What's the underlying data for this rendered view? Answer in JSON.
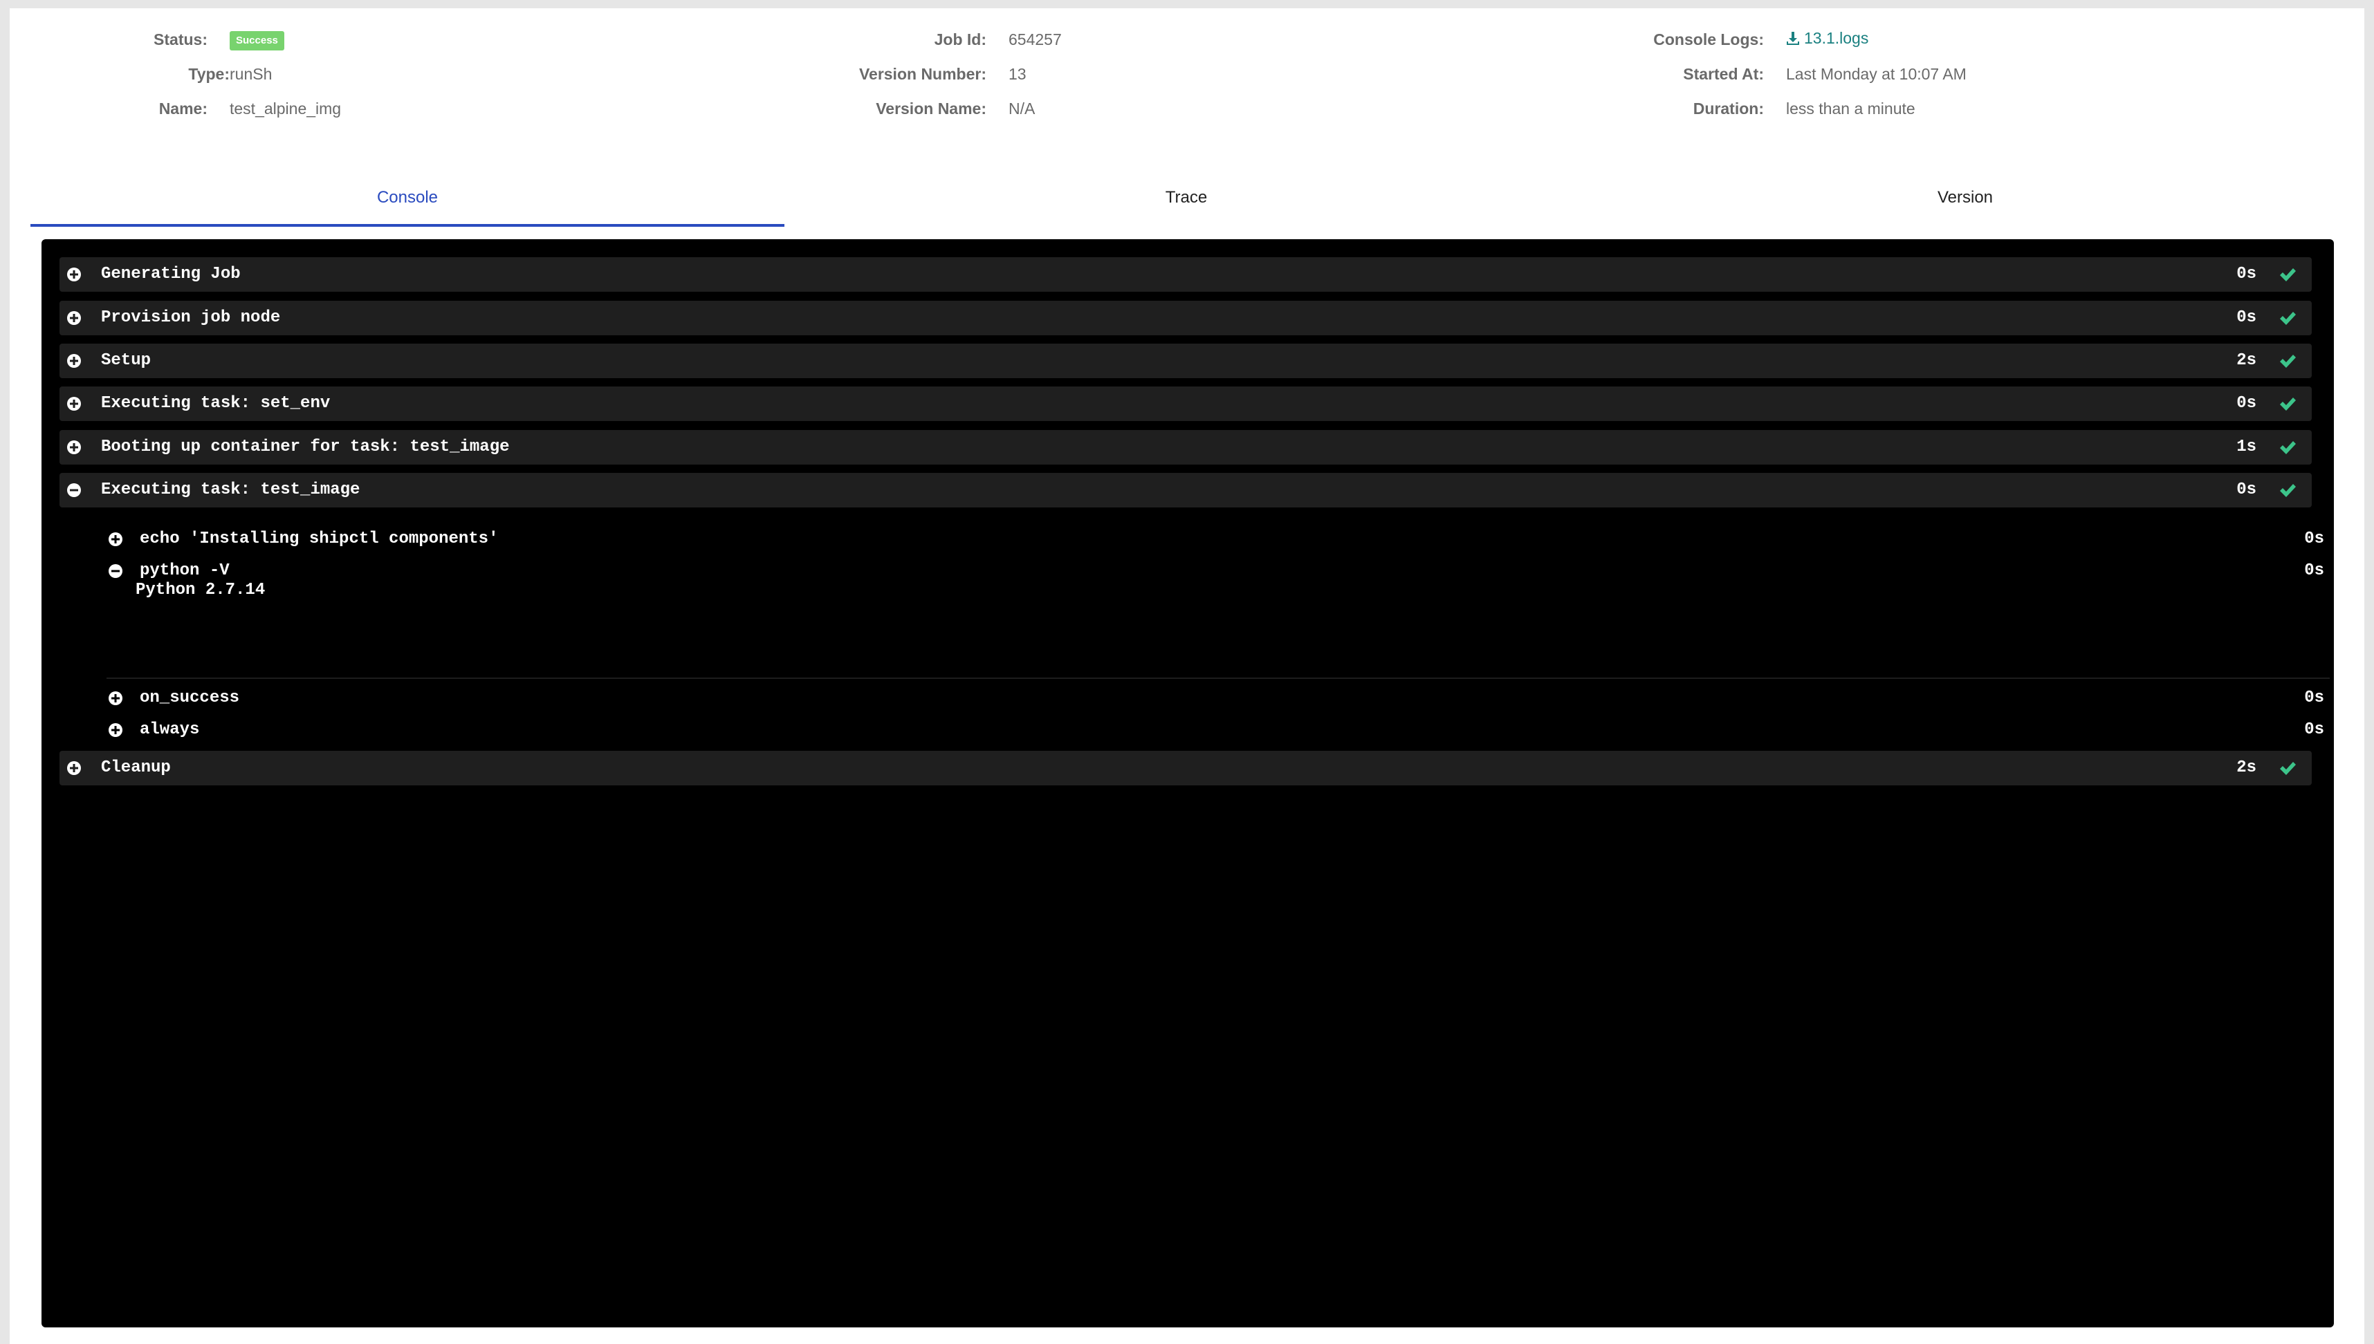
{
  "info": {
    "status_label": "Status:",
    "status_value": "Success",
    "type_label": "Type:",
    "type_value": "runSh",
    "name_label": "Name:",
    "name_value": "test_alpine_img",
    "job_id_label": "Job Id:",
    "job_id_value": "654257",
    "version_number_label": "Version Number:",
    "version_number_value": "13",
    "version_name_label": "Version Name:",
    "version_name_value": "N/A",
    "console_logs_label": "Console Logs:",
    "console_logs_value": "13.1.logs",
    "started_at_label": "Started At:",
    "started_at_value": "Last Monday at 10:07 AM",
    "duration_label": "Duration:",
    "duration_value": "less than a minute"
  },
  "tabs": [
    {
      "label": "Console",
      "active": true
    },
    {
      "label": "Trace",
      "active": false
    },
    {
      "label": "Version",
      "active": false
    }
  ],
  "console": {
    "sections": [
      {
        "title": "Generating Job",
        "duration": "0s",
        "expanded": false,
        "status_icon": "check-icon"
      },
      {
        "title": "Provision job node",
        "duration": "0s",
        "expanded": false,
        "status_icon": "check-icon"
      },
      {
        "title": "Setup",
        "duration": "2s",
        "expanded": false,
        "status_icon": "check-icon"
      },
      {
        "title": "Executing task: set_env",
        "duration": "0s",
        "expanded": false,
        "status_icon": "check-icon"
      },
      {
        "title": "Booting up container for task: test_image",
        "duration": "1s",
        "expanded": false,
        "status_icon": "check-icon"
      },
      {
        "title": "Executing task: test_image",
        "duration": "0s",
        "expanded": true,
        "status_icon": "check-icon"
      },
      {
        "title": "Cleanup",
        "duration": "2s",
        "expanded": false,
        "status_icon": "check-icon"
      }
    ],
    "commands": [
      {
        "title": "echo 'Installing shipctl components'",
        "duration": "0s",
        "expanded": false
      },
      {
        "title": "python -V",
        "duration": "0s",
        "expanded": true
      },
      {
        "title": "on_success",
        "duration": "0s",
        "expanded": false
      },
      {
        "title": "always",
        "duration": "0s",
        "expanded": false
      }
    ],
    "output": "Python 2.7.14"
  },
  "colors": {
    "accent": "#2a4bbf",
    "success_badge": "#78d36e",
    "check": "#3cc48a",
    "link": "#1a8080",
    "console_bg": "#000000",
    "section_bg": "#1f1f1f"
  }
}
